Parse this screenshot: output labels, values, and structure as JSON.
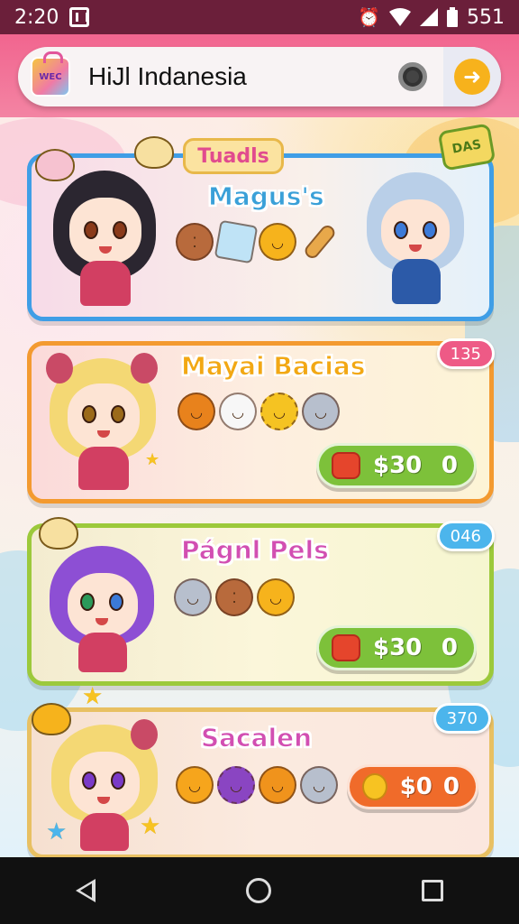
{
  "status_bar": {
    "time": "2:20",
    "right_text": "551",
    "icons": [
      "app-icon",
      "alarm-icon",
      "wifi-icon",
      "signal-icon",
      "battery-icon"
    ]
  },
  "search": {
    "logo_text": "WEC",
    "query": "HiJl Indanesia",
    "icons": [
      "camera-icon",
      "arrow-right-icon"
    ],
    "go_symbol": "➜"
  },
  "cards": [
    {
      "ribbon": "Tuadls",
      "corner_tag": "DAS",
      "title": "Magus's",
      "items": [
        "cookie",
        "ice-cube",
        "pumpkin",
        "stick"
      ],
      "colors": {
        "border": "#3f9ee6",
        "bg": "#f8e7f1",
        "title": "#3aa0d8"
      }
    },
    {
      "title": "Mayai Bacias",
      "badge": "135",
      "items": [
        "pumpkin",
        "ghost",
        "sun",
        "ghost"
      ],
      "price": "$30",
      "price_suffix": "0",
      "colors": {
        "border": "#f39a30",
        "bg": "#fde8e4",
        "title": "#f2a814",
        "badge": "#ee5a86",
        "button": "#7dc13a"
      }
    },
    {
      "title": "Págnl Pels",
      "badge": "046",
      "items": [
        "ghost",
        "cookie",
        "pumpkin"
      ],
      "price": "$30",
      "price_suffix": "0",
      "colors": {
        "border": "#9cc93b",
        "bg": "#fbf4d8",
        "title": "#d24fb2",
        "badge": "#4cb5ec",
        "button": "#7dc13a"
      }
    },
    {
      "title": "Sacalen",
      "badge": "370",
      "items": [
        "pumpkin",
        "monster",
        "pumpkin",
        "ghost"
      ],
      "price": "$0",
      "price_suffix": "0",
      "colors": {
        "border": "#e8c062",
        "bg": "#fbe7df",
        "title": "#d24fb2",
        "badge": "#4cb5ec",
        "button": "#f06b2a"
      }
    }
  ],
  "nav": {
    "icons": [
      "back-icon",
      "home-icon",
      "recents-icon"
    ]
  }
}
